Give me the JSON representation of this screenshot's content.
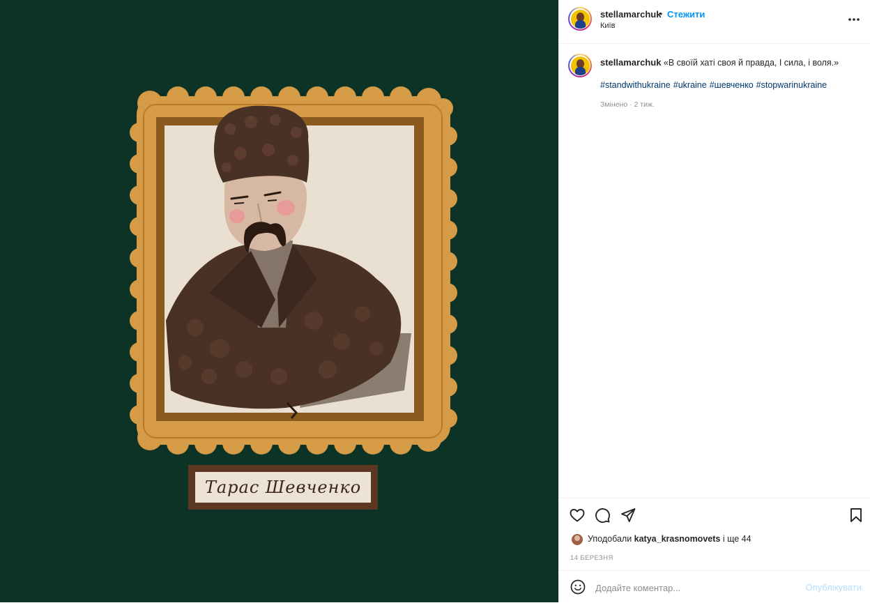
{
  "post": {
    "username": "stellamarchuk",
    "follow_label": "Стежити",
    "separator": "•",
    "location": "Київ"
  },
  "artwork": {
    "nameplate_text": "Тарас Шевченко"
  },
  "caption": {
    "username": "stellamarchuk",
    "text": "«В своїй хаті своя й правда, І сила, і воля.»",
    "hashtags": [
      "#standwithukraine",
      "#ukraine",
      "#шевченко",
      "#stopwarinukraine"
    ],
    "meta": "Змінено · 2 тиж."
  },
  "engagement": {
    "likes_prefix": "Уподобали",
    "likes_user": "katya_krasnomovets",
    "likes_suffix": "і ще 44",
    "date": "14 БЕРЕЗНЯ"
  },
  "comment": {
    "placeholder": "Додайте коментар...",
    "publish_label": "Опублікувати"
  },
  "icons": {
    "more": "more-options-icon",
    "like": "heart-icon",
    "comment": "comment-icon",
    "share": "paper-plane-icon",
    "save": "bookmark-icon",
    "emoji": "emoji-icon"
  },
  "colors": {
    "image_background": "#0d3327",
    "frame_gold": "#d59a45",
    "link_blue": "#0095f6",
    "hashtag_blue": "#00376b"
  }
}
